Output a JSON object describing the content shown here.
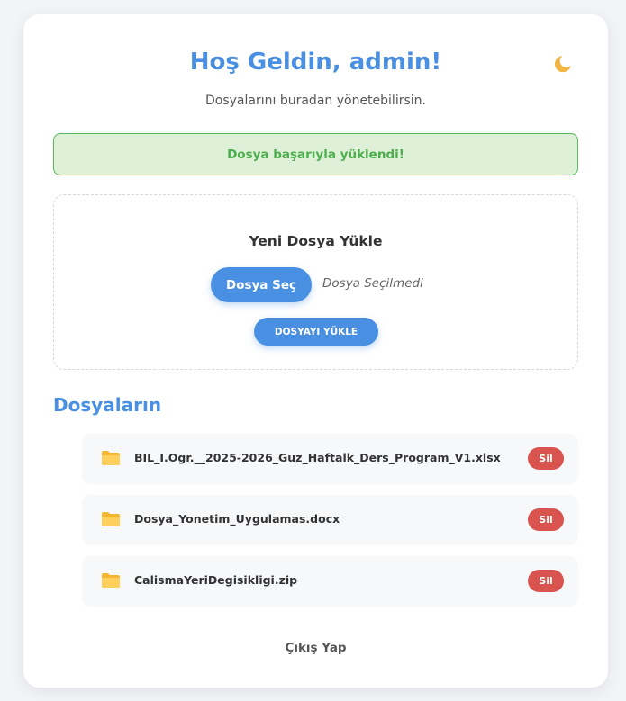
{
  "header": {
    "title": "Hoş Geldin, admin!",
    "subtitle": "Dosyalarını buradan yönetebilirsin.",
    "theme_toggle_icon": "moon-icon"
  },
  "alert": {
    "message": "Dosya başarıyla yüklendi!",
    "color": "#5cb85c"
  },
  "upload": {
    "title": "Yeni Dosya Yükle",
    "choose_label": "Dosya Seç",
    "no_file_text": "Dosya Seçilmedi",
    "submit_label": "DOSYAYI YÜKLE"
  },
  "files": {
    "heading": "Dosyaların",
    "items": [
      {
        "name": "BIL_I.Ogr.__2025-2026_Guz_Haftalk_Ders_Program_V1.xlsx",
        "delete_label": "Sil"
      },
      {
        "name": "Dosya_Yonetim_Uygulamas.docx",
        "delete_label": "Sil"
      },
      {
        "name": "CalismaYeriDegisikligi.zip",
        "delete_label": "Sil"
      }
    ]
  },
  "footer": {
    "logout_label": "Çıkış Yap"
  },
  "colors": {
    "accent": "#4a90e2",
    "danger": "#d9534f",
    "success": "#5cb85c"
  }
}
